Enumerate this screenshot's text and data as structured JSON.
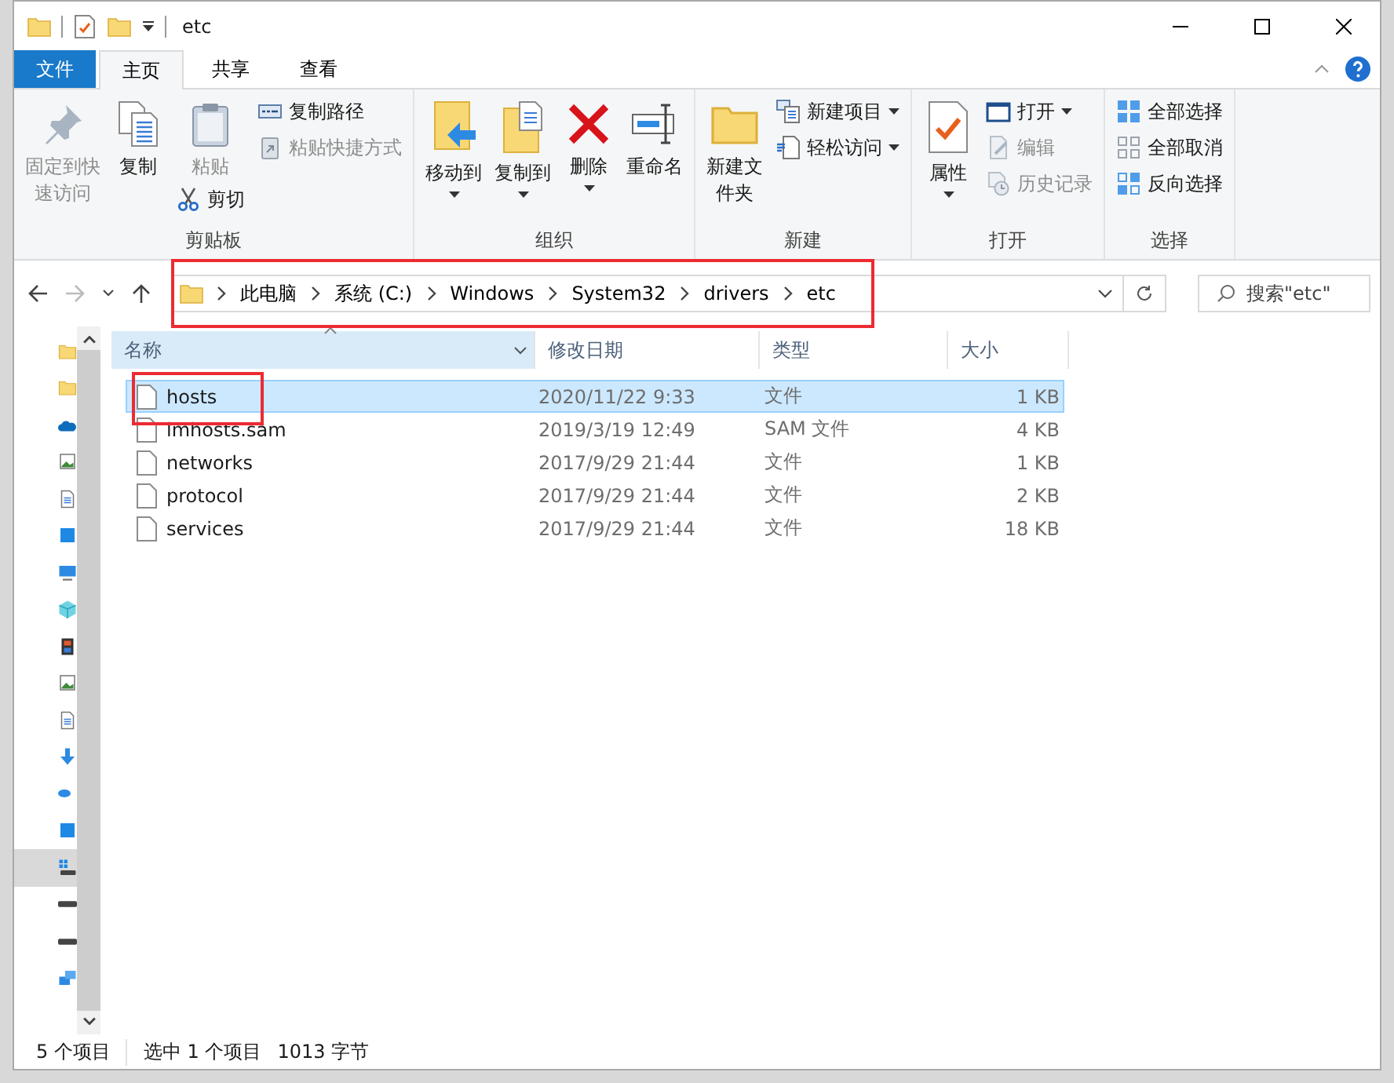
{
  "window": {
    "title": "etc"
  },
  "ribbon_tabs": [
    {
      "label": "文件",
      "kind": "file",
      "selected": false
    },
    {
      "label": "主页",
      "kind": "tab",
      "selected": true
    },
    {
      "label": "共享",
      "kind": "tab",
      "selected": false
    },
    {
      "label": "查看",
      "kind": "tab",
      "selected": false
    }
  ],
  "ribbon_groups": [
    {
      "label": "剪贴板",
      "columns": [
        [
          {
            "label": "固定到快速访问",
            "kind": "large",
            "disabled": true,
            "dropdown": false
          }
        ],
        [
          {
            "label": "复制",
            "kind": "large",
            "disabled": false,
            "dropdown": false
          }
        ],
        [
          {
            "label": "粘贴",
            "kind": "large",
            "disabled": true,
            "dropdown": false
          },
          {
            "label": "剪切",
            "kind": "small",
            "disabled": false,
            "dropdown": false
          }
        ],
        [
          {
            "label": "复制路径",
            "kind": "small",
            "disabled": false,
            "dropdown": false
          },
          {
            "label": "粘贴快捷方式",
            "kind": "small",
            "disabled": true,
            "dropdown": false
          }
        ]
      ]
    },
    {
      "label": "组织",
      "columns": [
        [
          {
            "label": "移动到",
            "kind": "large",
            "disabled": false,
            "dropdown": true
          }
        ],
        [
          {
            "label": "复制到",
            "kind": "large",
            "disabled": false,
            "dropdown": true
          }
        ],
        [
          {
            "label": "删除",
            "kind": "large",
            "disabled": false,
            "dropdown": true
          }
        ],
        [
          {
            "label": "重命名",
            "kind": "large",
            "disabled": false,
            "dropdown": false
          }
        ]
      ]
    },
    {
      "label": "新建",
      "columns": [
        [
          {
            "label": "新建文件夹",
            "kind": "large",
            "disabled": false,
            "dropdown": false
          }
        ],
        [
          {
            "label": "新建项目",
            "kind": "small",
            "disabled": false,
            "dropdown": true
          },
          {
            "label": "轻松访问",
            "kind": "small",
            "disabled": false,
            "dropdown": true
          }
        ]
      ]
    },
    {
      "label": "打开",
      "columns": [
        [
          {
            "label": "属性",
            "kind": "large",
            "disabled": false,
            "dropdown": true
          }
        ],
        [
          {
            "label": "打开",
            "kind": "small",
            "disabled": false,
            "dropdown": true
          },
          {
            "label": "编辑",
            "kind": "small",
            "disabled": true,
            "dropdown": false
          },
          {
            "label": "历史记录",
            "kind": "small",
            "disabled": true,
            "dropdown": false
          }
        ]
      ]
    },
    {
      "label": "选择",
      "columns": [
        [
          {
            "label": "全部选择",
            "kind": "small",
            "disabled": false,
            "dropdown": false
          },
          {
            "label": "全部取消",
            "kind": "small",
            "disabled": false,
            "dropdown": false
          },
          {
            "label": "反向选择",
            "kind": "small",
            "disabled": false,
            "dropdown": false
          }
        ]
      ]
    }
  ],
  "address_bar": {
    "crumbs": [
      "此电脑",
      "系统 (C:)",
      "Windows",
      "System32",
      "drivers",
      "etc"
    ]
  },
  "search": {
    "placeholder": "搜索\"etc\""
  },
  "navigation_pane": {
    "items": [
      {
        "selected": false
      },
      {
        "selected": false
      },
      {
        "selected": false
      },
      {
        "selected": false
      },
      {
        "selected": false
      },
      {
        "selected": false
      },
      {
        "selected": false
      },
      {
        "selected": false
      },
      {
        "selected": false
      },
      {
        "selected": false
      },
      {
        "selected": false
      },
      {
        "selected": false
      },
      {
        "selected": false
      },
      {
        "selected": false
      },
      {
        "selected": true
      },
      {
        "selected": false
      },
      {
        "selected": false
      },
      {
        "selected": false
      }
    ]
  },
  "file_list": {
    "columns": [
      {
        "label": "名称",
        "sorted": true,
        "highlighted": true
      },
      {
        "label": "修改日期",
        "sorted": false,
        "highlighted": false
      },
      {
        "label": "类型",
        "sorted": false,
        "highlighted": false
      },
      {
        "label": "大小",
        "sorted": false,
        "highlighted": false
      }
    ],
    "rows": [
      {
        "name": "hosts",
        "modified": "2020/11/22 9:33",
        "type": "文件",
        "size": "1 KB",
        "selected": true
      },
      {
        "name": "lmhosts.sam",
        "modified": "2019/3/19 12:49",
        "type": "SAM 文件",
        "size": "4 KB",
        "selected": false
      },
      {
        "name": "networks",
        "modified": "2017/9/29 21:44",
        "type": "文件",
        "size": "1 KB",
        "selected": false
      },
      {
        "name": "protocol",
        "modified": "2017/9/29 21:44",
        "type": "文件",
        "size": "2 KB",
        "selected": false
      },
      {
        "name": "services",
        "modified": "2017/9/29 21:44",
        "type": "文件",
        "size": "18 KB",
        "selected": false
      }
    ]
  },
  "status_bar": {
    "items": [
      "5 个项目",
      "选中 1 个项目",
      "1013 字节"
    ]
  }
}
